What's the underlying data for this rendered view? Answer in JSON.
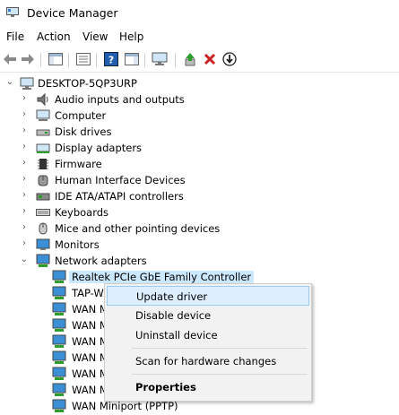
{
  "window": {
    "title": "Device Manager"
  },
  "menu": [
    "File",
    "Action",
    "View",
    "Help"
  ],
  "toolbar": {
    "buttons": [
      "back-icon",
      "forward-icon",
      "show-hide-console-tree-icon",
      "properties-icon",
      "help-icon",
      "action-pane-icon",
      "display-icon",
      "update-driver-icon",
      "uninstall-icon",
      "enable-device-icon"
    ],
    "uninstall_color": "#cc2222",
    "update_color": "#2a9d2a"
  },
  "tree": {
    "root": "DESKTOP-5QP3URP",
    "categories": [
      {
        "label": "Audio inputs and outputs",
        "icon": "speaker-icon"
      },
      {
        "label": "Computer",
        "icon": "computer-icon"
      },
      {
        "label": "Disk drives",
        "icon": "disk-drive-icon"
      },
      {
        "label": "Display adapters",
        "icon": "display-adapter-icon"
      },
      {
        "label": "Firmware",
        "icon": "firmware-chip-icon"
      },
      {
        "label": "Human Interface Devices",
        "icon": "hid-icon"
      },
      {
        "label": "IDE ATA/ATAPI controllers",
        "icon": "ide-controller-icon"
      },
      {
        "label": "Keyboards",
        "icon": "keyboard-icon"
      },
      {
        "label": "Mice and other pointing devices",
        "icon": "mouse-icon"
      },
      {
        "label": "Monitors",
        "icon": "monitor-icon"
      },
      {
        "label": "Network adapters",
        "icon": "network-adapter-icon"
      }
    ],
    "network_children": [
      "Realtek PCIe GbE Family Controller",
      "TAP-W",
      "WAN M",
      "WAN M",
      "WAN M",
      "WAN M",
      "WAN M",
      "WAN M",
      "WAN Miniport (PPTP)"
    ],
    "selected": "Realtek PCIe GbE Family Controller"
  },
  "context_menu": {
    "items": [
      "Update driver",
      "Disable device",
      "Uninstall device",
      "Scan for hardware changes",
      "Properties"
    ],
    "highlighted": "Update driver"
  }
}
